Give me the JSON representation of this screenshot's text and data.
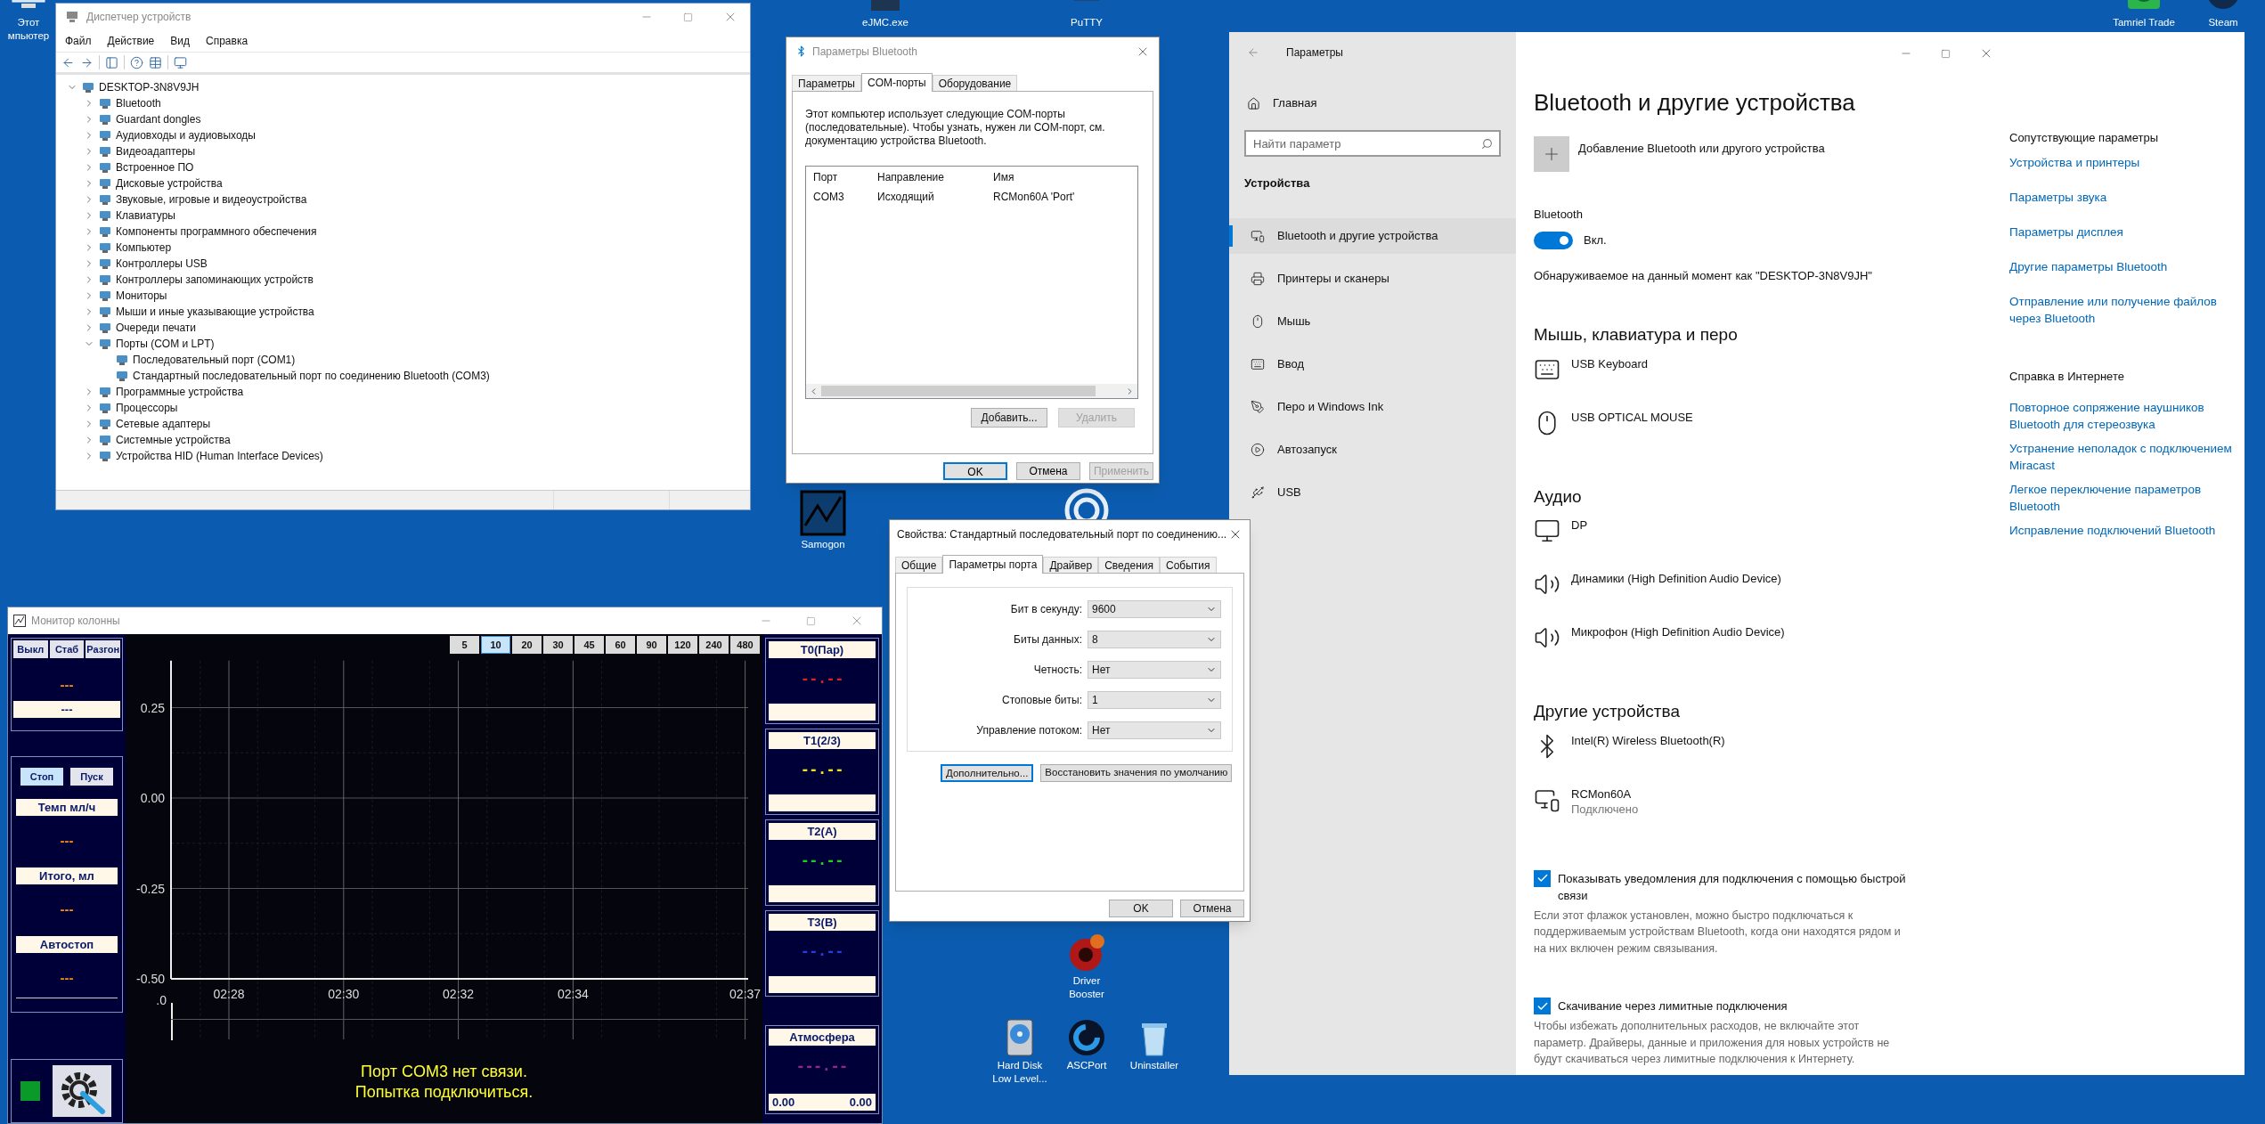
{
  "desktop_icons": [
    {
      "lines": [
        "Этот",
        "мпьютер"
      ],
      "kind": "computer"
    },
    {
      "lines": [
        "eJMC.exe"
      ],
      "kind": "app"
    },
    {
      "lines": [
        "PuTTY"
      ],
      "kind": "terminal"
    },
    {
      "lines": [
        "Tamriel Trade"
      ],
      "kind": "green"
    },
    {
      "lines": [
        "Steam"
      ],
      "kind": "dark"
    },
    {
      "lines": [
        "Samogon"
      ],
      "kind": "chart"
    },
    {
      "kind": "circle"
    },
    {
      "lines": [
        "Driver",
        "Booster"
      ],
      "kind": "gear"
    },
    {
      "lines": [
        "Hard Disk",
        "Low Level..."
      ],
      "kind": "disk"
    },
    {
      "lines": [
        "ASCPort"
      ],
      "kind": "ring"
    },
    {
      "lines": [
        "Uninstaller"
      ],
      "kind": "trash"
    }
  ],
  "device_manager": {
    "title": "Диспетчер устройств",
    "menu": [
      "Файл",
      "Действие",
      "Вид",
      "Справка"
    ],
    "tree": {
      "label": "DESKTOP-3N8V9JH",
      "expanded": true,
      "children": [
        {
          "label": "Bluetooth",
          "expanded": false
        },
        {
          "label": "Guardant dongles",
          "expanded": false
        },
        {
          "label": "Аудиовходы и аудиовыходы",
          "expanded": false
        },
        {
          "label": "Видеоадаптеры",
          "expanded": false
        },
        {
          "label": "Встроенное ПО",
          "expanded": false
        },
        {
          "label": "Дисковые устройства",
          "expanded": false
        },
        {
          "label": "Звуковые, игровые и видеоустройства",
          "expanded": false
        },
        {
          "label": "Клавиатуры",
          "expanded": false
        },
        {
          "label": "Компоненты программного обеспечения",
          "expanded": false
        },
        {
          "label": "Компьютер",
          "expanded": false
        },
        {
          "label": "Контроллеры USB",
          "expanded": false
        },
        {
          "label": "Контроллеры запоминающих устройств",
          "expanded": false
        },
        {
          "label": "Мониторы",
          "expanded": false
        },
        {
          "label": "Мыши и иные указывающие устройства",
          "expanded": false
        },
        {
          "label": "Очереди печати",
          "expanded": false
        },
        {
          "label": "Порты (COM и LPT)",
          "expanded": true,
          "children": [
            {
              "label": "Последовательный порт (COM1)"
            },
            {
              "label": "Стандартный последовательный порт по соединению Bluetooth (COM3)"
            }
          ]
        },
        {
          "label": "Программные устройства",
          "expanded": false
        },
        {
          "label": "Процессоры",
          "expanded": false
        },
        {
          "label": "Сетевые адаптеры",
          "expanded": false
        },
        {
          "label": "Системные устройства",
          "expanded": false
        },
        {
          "label": "Устройства HID (Human Interface Devices)",
          "expanded": false
        }
      ]
    }
  },
  "bluetooth_dialog": {
    "title": "Параметры Bluetooth",
    "tabs": [
      {
        "label": "Параметры",
        "selected": false
      },
      {
        "label": "COM-порты",
        "selected": true
      },
      {
        "label": "Оборудование",
        "selected": false
      }
    ],
    "description": "Этот компьютер использует следующие COM-порты (последовательные). Чтобы узнать, нужен ли COM-порт, см. документацию устройства Bluetooth.",
    "columns": [
      "Порт",
      "Направление",
      "Имя"
    ],
    "rows": [
      [
        "COM3",
        "Исходящий",
        "RCMon60A 'Port'"
      ]
    ],
    "list_buttons": [
      {
        "label": "Добавить...",
        "disabled": false
      },
      {
        "label": "Удалить",
        "disabled": true
      }
    ],
    "buttons": [
      {
        "label": "OK",
        "default": true,
        "disabled": false
      },
      {
        "label": "Отмена",
        "default": false,
        "disabled": false
      },
      {
        "label": "Применить",
        "default": false,
        "disabled": true
      }
    ]
  },
  "port_properties": {
    "title": "Свойства: Стандартный последовательный порт по соединению...",
    "tabs": [
      {
        "label": "Общие",
        "selected": false
      },
      {
        "label": "Параметры порта",
        "selected": true
      },
      {
        "label": "Драйвер",
        "selected": false
      },
      {
        "label": "Сведения",
        "selected": false
      },
      {
        "label": "События",
        "selected": false
      }
    ],
    "fields": [
      {
        "label": "Бит в секунду:",
        "value": "9600"
      },
      {
        "label": "Биты данных:",
        "value": "8"
      },
      {
        "label": "Четность:",
        "value": "Нет"
      },
      {
        "label": "Стоповые биты:",
        "value": "1"
      },
      {
        "label": "Управление потоком:",
        "value": "Нет"
      }
    ],
    "actions": [
      {
        "label": "Дополнительно...",
        "focused": true
      },
      {
        "label": "Восстановить значения по умолчанию",
        "focused": false
      }
    ],
    "buttons": [
      "OK",
      "Отмена"
    ]
  },
  "settings": {
    "title": "Параметры",
    "sidebar": {
      "home": "Главная",
      "search": {
        "placeholder": "Найти параметр"
      },
      "section": "Устройства",
      "items": [
        {
          "label": "Bluetooth и другие устройства",
          "kind": "devices",
          "selected": true
        },
        {
          "label": "Принтеры и сканеры",
          "kind": "printer",
          "selected": false
        },
        {
          "label": "Мышь",
          "kind": "mouse",
          "selected": false
        },
        {
          "label": "Ввод",
          "kind": "keyboard",
          "selected": false
        },
        {
          "label": "Перо и Windows Ink",
          "kind": "pen",
          "selected": false
        },
        {
          "label": "Автозапуск",
          "kind": "autoplay",
          "selected": false
        },
        {
          "label": "USB",
          "kind": "usb",
          "selected": false
        }
      ]
    },
    "heading": "Bluetooth и другие устройства",
    "add_device": "Добавление Bluetooth или другого устройства",
    "bluetooth": {
      "label": "Bluetooth",
      "on": true,
      "state_label": "Вкл.",
      "discoverable": "Обнаруживаемое на данный момент как \"DESKTOP-3N8V9JH\""
    },
    "groups": [
      {
        "title": "Мышь, клавиатура и перо",
        "devices": [
          {
            "name": "USB Keyboard",
            "kind": "keyboard"
          },
          {
            "name": "USB OPTICAL MOUSE",
            "kind": "mouse"
          }
        ]
      },
      {
        "title": "Аудио",
        "devices": [
          {
            "name": "DP",
            "kind": "monitor"
          },
          {
            "name": "Динамики (High Definition Audio Device)",
            "kind": "speaker"
          },
          {
            "name": "Микрофон (High Definition Audio Device)",
            "kind": "speaker"
          }
        ]
      },
      {
        "title": "Другие устройства",
        "devices": [
          {
            "name": "Intel(R) Wireless Bluetooth(R)",
            "kind": "bluetooth"
          },
          {
            "name": "RCMon60A",
            "kind": "devices",
            "status": "Подключено"
          }
        ]
      }
    ],
    "options": [
      {
        "label": "Показывать уведомления для подключения с помощью быстрой связи",
        "checked": true,
        "description": "Если этот флажок установлен, можно быстро подключаться к поддерживаемым устройствам Bluetooth, когда они находятся рядом и на них включен режим связывания."
      },
      {
        "label": "Скачивание через лимитные подключения",
        "checked": true,
        "description": "Чтобы избежать дополнительных расходов, не включайте этот параметр. Драйверы, данные и приложения для новых устройств не будут скачиваться через лимитные подключения к Интернету."
      }
    ],
    "related": {
      "title": "Сопутствующие параметры",
      "links": [
        "Устройства и принтеры",
        "Параметры звука",
        "Параметры дисплея",
        "Другие параметры Bluetooth",
        "Отправление или получение файлов через Bluetooth"
      ]
    },
    "help": {
      "title": "Справка в Интернете",
      "links": [
        "Повторное сопряжение наушников Bluetooth для стереозвука",
        "Устранение неполадок с подключением Miracast",
        "Легкое переключение параметров Bluetooth",
        "Исправление подключений Bluetooth"
      ]
    }
  },
  "monitor": {
    "title": "Монитор колонны",
    "mode_buttons": [
      "Выкл",
      "Стаб",
      "Разгон"
    ],
    "mode_reading": "---",
    "mode_value": "---",
    "run_buttons": [
      {
        "label": "Стоп",
        "selected": true
      },
      {
        "label": "Пуск",
        "selected": false
      }
    ],
    "counters": [
      {
        "label": "Темп мл/ч",
        "value": "---"
      },
      {
        "label": "Итого, мл",
        "value": "---"
      },
      {
        "label": "Автостоп",
        "value": "---"
      }
    ],
    "range_buttons": [
      {
        "label": "5",
        "selected": false
      },
      {
        "label": "10",
        "selected": true
      },
      {
        "label": "20",
        "selected": false
      },
      {
        "label": "30",
        "selected": false
      },
      {
        "label": "45",
        "selected": false
      },
      {
        "label": "60",
        "selected": false
      },
      {
        "label": "90",
        "selected": false
      },
      {
        "label": "120",
        "selected": false
      },
      {
        "label": "240",
        "selected": false
      },
      {
        "label": "480",
        "selected": false
      }
    ],
    "chart_data": {
      "type": "line",
      "grid": true,
      "ylim": [
        -0.5,
        0.38
      ],
      "yticks": [
        {
          "value": 0.25,
          "label": "0.25"
        },
        {
          "value": 0,
          "label": "0.00"
        },
        {
          "value": -0.25,
          "label": "-0.25"
        },
        {
          "value": -0.5,
          "label": "-0.50"
        }
      ],
      "categories": [
        "02:28",
        null,
        "02:30",
        null,
        "02:32",
        null,
        "02:34",
        null,
        null,
        "02:37"
      ]
    },
    "lower_axis_label": ".0",
    "message": [
      "Порт COM3 нет связи.",
      "Попытка подключиться."
    ],
    "sensors": [
      {
        "label": "T0(Пар)",
        "reading": "--.--",
        "color": "#e02020"
      },
      {
        "label": "T1(2/3)",
        "reading": "--.--",
        "color": "#f0e020"
      },
      {
        "label": "T2(A)",
        "reading": "--.--",
        "color": "#20d020"
      },
      {
        "label": "T3(B)",
        "reading": "--.--",
        "color": "#2040e0"
      }
    ],
    "atmosphere": {
      "label": "Атмосфера",
      "reading": "---.--",
      "color": "#a02090",
      "values": [
        "0.00",
        "0.00"
      ]
    }
  }
}
